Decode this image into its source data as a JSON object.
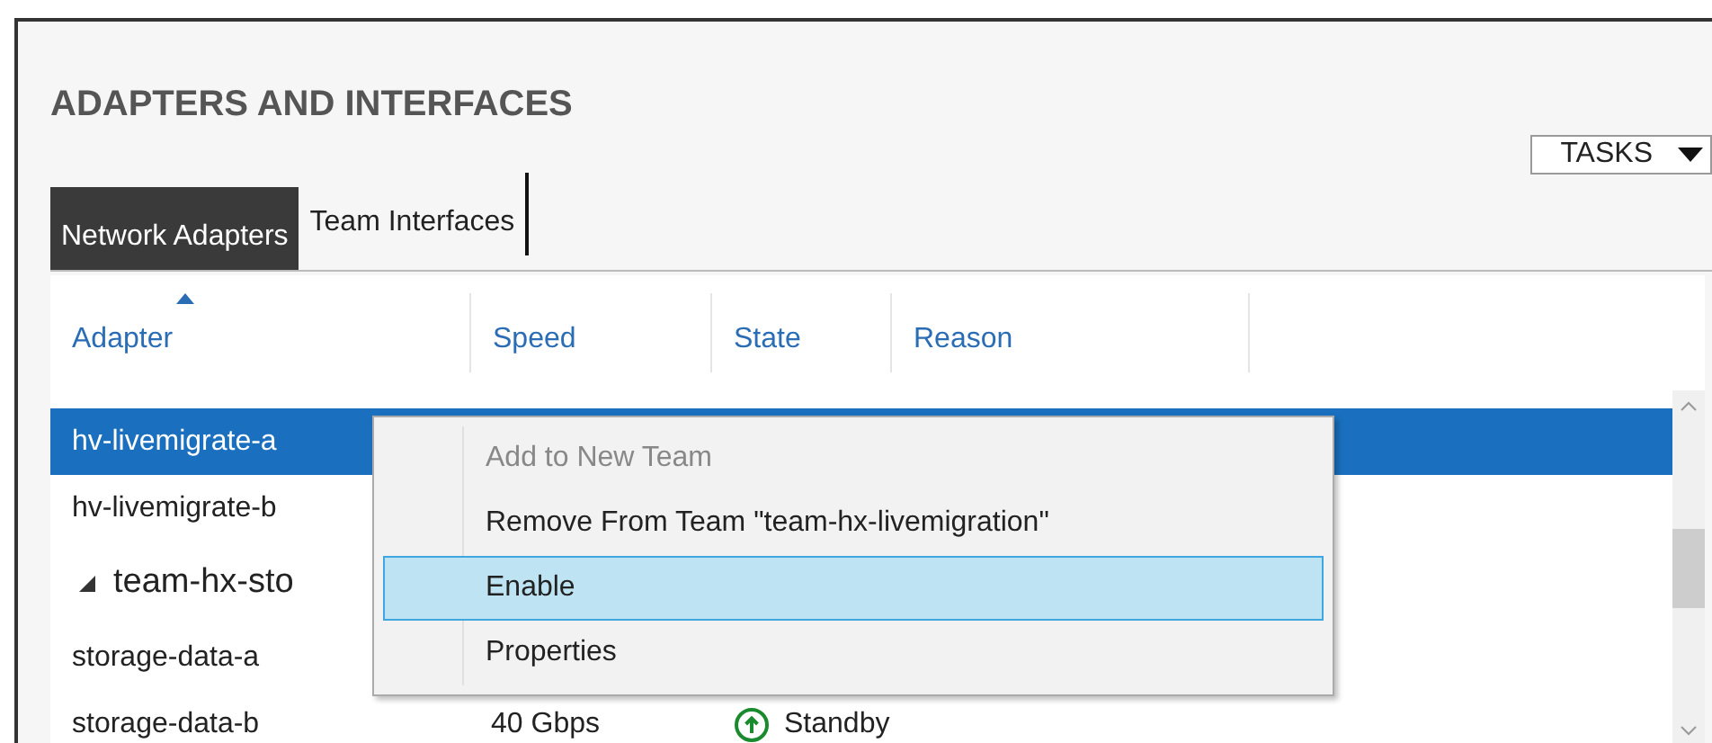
{
  "title": "ADAPTERS AND INTERFACES",
  "tasks_button": {
    "label": "TASKS"
  },
  "tabs": [
    {
      "label": "Network Adapters",
      "selected": true
    },
    {
      "label": "Team Interfaces",
      "selected": false
    }
  ],
  "table": {
    "columns": [
      {
        "label": "Adapter",
        "sorted": true
      },
      {
        "label": "Speed",
        "sorted": false
      },
      {
        "label": "State",
        "sorted": false
      },
      {
        "label": "Reason",
        "sorted": false
      }
    ],
    "rows": [
      {
        "kind": "adapter",
        "adapter": "hv-livemigrate-a",
        "selected": true
      },
      {
        "kind": "adapter",
        "adapter": "hv-livemigrate-b",
        "selected": false
      },
      {
        "kind": "team",
        "name": "team-hx-sto",
        "expanded": true,
        "selected": false,
        "children": [
          {
            "kind": "adapter",
            "adapter": "storage-data-a",
            "selected": false
          },
          {
            "kind": "adapter",
            "adapter": "storage-data-b",
            "speed": "40 Gbps",
            "state": "Standby",
            "selected": false
          }
        ]
      }
    ]
  },
  "context_menu": {
    "items": [
      {
        "label": "Add to New Team",
        "disabled": true,
        "selected": false
      },
      {
        "label": "Remove From Team \"team-hx-livemigration\"",
        "disabled": false,
        "selected": false
      },
      {
        "label": "Enable",
        "disabled": false,
        "selected": true
      },
      {
        "label": "Properties",
        "disabled": false,
        "selected": false
      }
    ]
  }
}
